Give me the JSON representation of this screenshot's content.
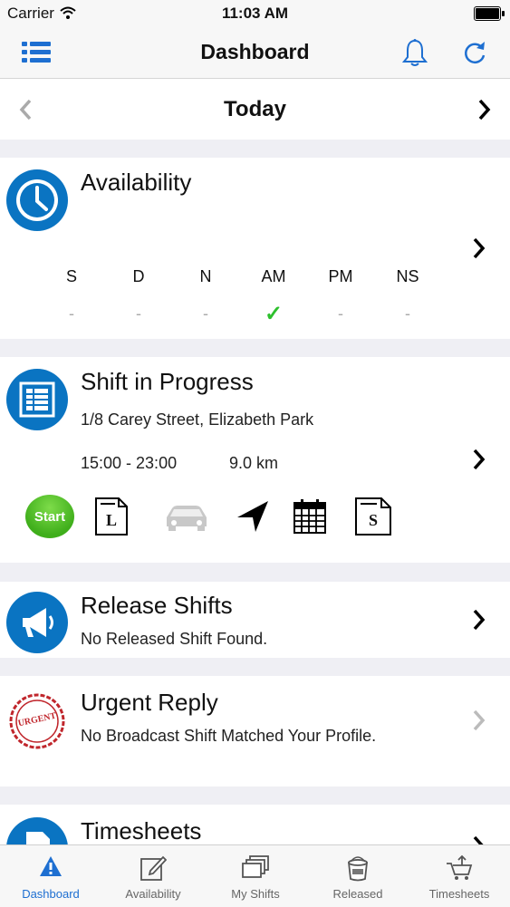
{
  "status_bar": {
    "carrier": "Carrier",
    "time": "11:03 AM"
  },
  "nav": {
    "title": "Dashboard"
  },
  "date_bar": {
    "label": "Today"
  },
  "availability": {
    "title": "Availability",
    "columns": [
      {
        "code": "S",
        "value": "-"
      },
      {
        "code": "D",
        "value": "-"
      },
      {
        "code": "N",
        "value": "-"
      },
      {
        "code": "AM",
        "value": "✓"
      },
      {
        "code": "PM",
        "value": "-"
      },
      {
        "code": "NS",
        "value": "-"
      }
    ]
  },
  "shift": {
    "title": "Shift in Progress",
    "address": "1/8 Carey Street, Elizabeth Park",
    "time": "15:00 - 23:00",
    "distance": "9.0 km",
    "start_label": "Start",
    "l_doc_letter": "L",
    "s_doc_letter": "S"
  },
  "release": {
    "title": "Release Shifts",
    "message": "No Released Shift Found."
  },
  "urgent": {
    "title": "Urgent Reply",
    "message": "No Broadcast Shift Matched Your Profile.",
    "stamp_text": "URGENT"
  },
  "timesheets": {
    "title": "Timesheets"
  },
  "tabs": [
    {
      "label": "Dashboard",
      "active": true
    },
    {
      "label": "Availability",
      "active": false
    },
    {
      "label": "My Shifts",
      "active": false
    },
    {
      "label": "Released",
      "active": false
    },
    {
      "label": "Timesheets",
      "active": false
    }
  ],
  "colors": {
    "accent": "#1e6fd1",
    "brand_blue": "#0a74c2",
    "check_green": "#2ec02e",
    "start_green": "#3fae1b",
    "urgent_red": "#c0262c"
  }
}
